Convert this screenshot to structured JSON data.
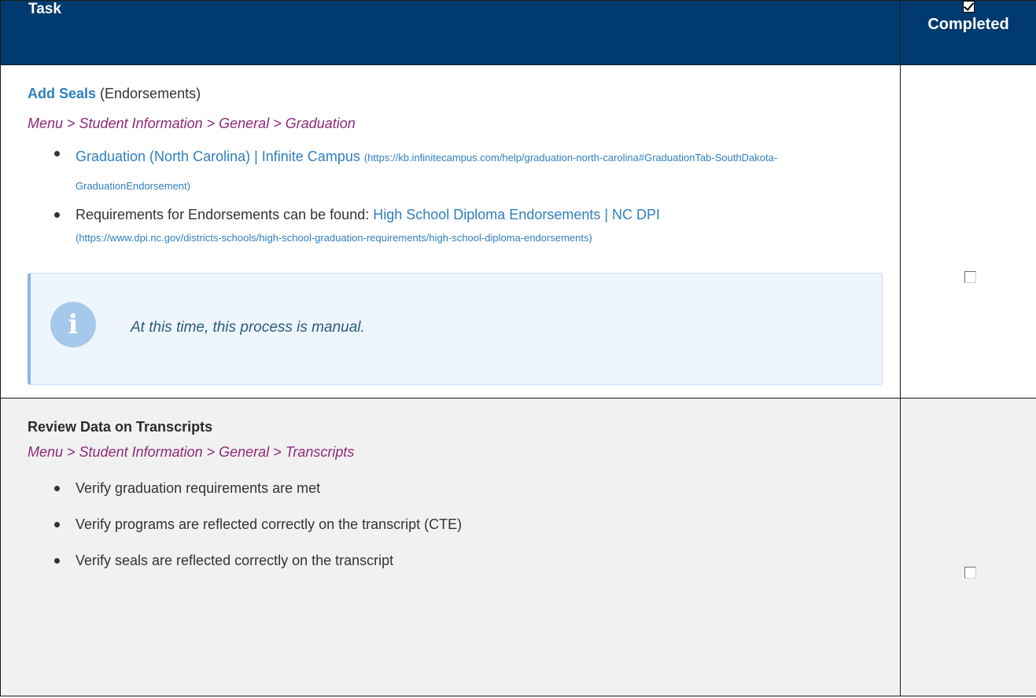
{
  "header": {
    "task_label": "Task",
    "completed_label": "Completed"
  },
  "rows": [
    {
      "title_link": "Add Seals",
      "title_suffix": " (Endorsements)",
      "path": "Menu > Student Information > General > Graduation",
      "items": [
        {
          "link_text": "Graduation (North Carolina) | Infinite Campus",
          "url": "(https://kb.infinitecampus.com/help/graduation-north-carolina#GraduationTab-SouthDakota-GraduationEndorsement)"
        },
        {
          "prefix": "Requirements for Endorsements can be found: ",
          "link_text": "High School Diploma Endorsements | NC DPI",
          "url": "(https://www.dpi.nc.gov/districts-schools/high-school-graduation-requirements/high-school-diploma-endorsements)"
        }
      ],
      "callout": {
        "icon": "info-icon",
        "text": "At this time, this process is manual."
      },
      "completed": false
    },
    {
      "title": "Review Data on Transcripts",
      "path": "Menu > Student Information > General > Transcripts",
      "items": [
        "Verify graduation requirements are met",
        "Verify programs are reflected correctly on the transcript (CTE)",
        "Verify seals are reflected correctly on the transcript"
      ],
      "completed": false
    }
  ],
  "colors": {
    "header_bg": "#003a6e",
    "link": "#2f7fbf",
    "path": "#8d2a7a",
    "callout_bg": "#eef5fd"
  }
}
